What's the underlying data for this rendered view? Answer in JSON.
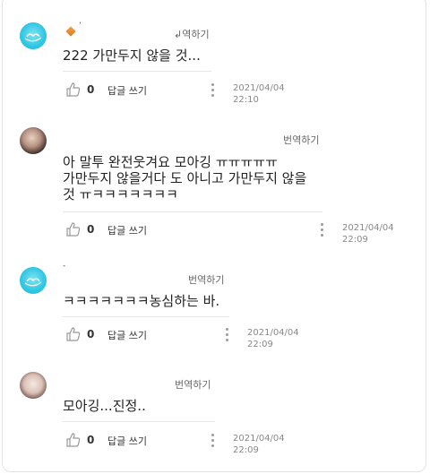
{
  "comments": [
    {
      "name_fragment": "",
      "translate_label": "번역하기",
      "translate_partial": "↲역하기",
      "text": "222 가만두지 않을 것...",
      "likes": "0",
      "reply_label": "답글 쓰기",
      "date": "2021/04/04",
      "time": "22:10"
    },
    {
      "translate_label": "번역하기",
      "text_lines": [
        "아 말투 완전웃겨요 모아깅 ㅠㅠㅠㅠㅠ",
        "가만두지 않을거다 도 아니고 가만두지 않을",
        "것 ㅠㅋㅋㅋㅋㅋㅋㅋ"
      ],
      "likes": "0",
      "reply_label": "답글 쓰기",
      "date": "2021/04/04",
      "time": "22:09"
    },
    {
      "translate_label": "번역하기",
      "text": "ㅋㅋㅋㅋㅋㅋㅋ농심하는 바.",
      "likes": "0",
      "reply_label": "답글 쓰기",
      "date": "2021/04/04",
      "time": "22:09"
    },
    {
      "translate_label": "번역하기",
      "text": "모아깅...진정..",
      "likes": "0",
      "reply_label": "답글 쓰기",
      "date": "2021/04/04",
      "time": "22:09"
    }
  ],
  "icons": {
    "like": "thumbs-up-icon",
    "more": "more-vertical-icon",
    "avatar_default": "heart-logo-avatar"
  },
  "colors": {
    "avatar_blue": "#2fc6e3",
    "text": "#222222",
    "muted": "#888888",
    "divider": "#e6e6e6"
  }
}
